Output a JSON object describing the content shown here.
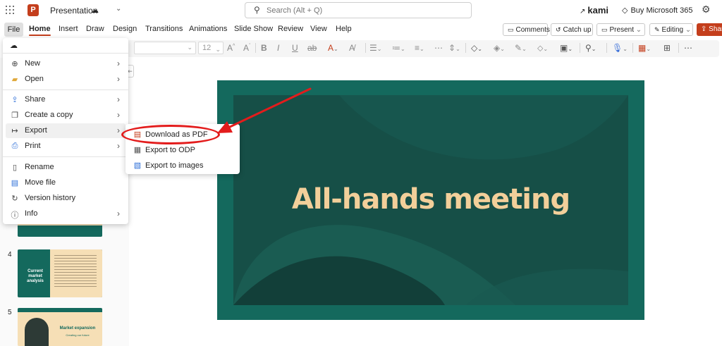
{
  "titlebar": {
    "app_logo": "P",
    "doc_title": "Presentation",
    "search_placeholder": "Search (Alt + Q)",
    "kami_label": "kami",
    "buy_label": "Buy Microsoft 365"
  },
  "menubar": {
    "tabs": [
      "File",
      "Home",
      "Insert",
      "Draw",
      "Design",
      "Transitions",
      "Animations",
      "Slide Show",
      "Review",
      "View",
      "Help"
    ],
    "comments": "Comments",
    "catch_up": "Catch up",
    "present": "Present",
    "editing": "Editing",
    "share": "Share"
  },
  "ribbon": {
    "font_size": "12"
  },
  "file_menu": {
    "items": [
      {
        "label": "New",
        "icon": "plus-circle-icon"
      },
      {
        "label": "Open",
        "icon": "folder-icon"
      },
      {
        "label": "Share",
        "icon": "share-icon"
      },
      {
        "label": "Create a copy",
        "icon": "copy-icon"
      },
      {
        "label": "Export",
        "icon": "export-icon"
      },
      {
        "label": "Print",
        "icon": "print-icon"
      },
      {
        "label": "Rename",
        "icon": "rename-icon"
      },
      {
        "label": "Move file",
        "icon": "move-file-icon"
      },
      {
        "label": "Version history",
        "icon": "history-icon"
      },
      {
        "label": "Info",
        "icon": "info-icon"
      }
    ]
  },
  "export_submenu": {
    "items": [
      {
        "label": "Download as PDF",
        "icon": "pdf-icon"
      },
      {
        "label": "Export to ODP",
        "icon": "odp-icon"
      },
      {
        "label": "Export to images",
        "icon": "image-icon"
      }
    ]
  },
  "slide": {
    "title": "All-hands meeting",
    "background": "#14695d",
    "title_color": "#f2cf9a"
  },
  "thumbnails": [
    {
      "number": "4",
      "title": "Current market analysis"
    },
    {
      "number": "5",
      "title": "Market expansion",
      "subtitle": "Creating our future"
    }
  ],
  "colors": {
    "accent": "#c43e1c",
    "annotation": "#e31c1c"
  }
}
